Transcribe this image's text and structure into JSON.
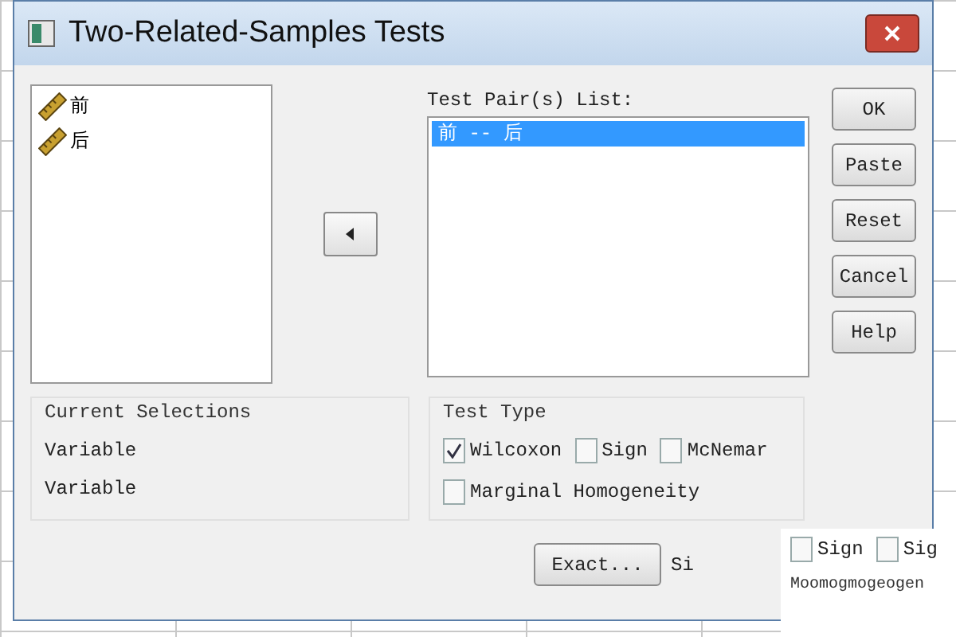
{
  "window": {
    "title": "Two-Related-Samples Tests"
  },
  "variables": [
    {
      "name": "前"
    },
    {
      "name": "后"
    }
  ],
  "test_pairs": {
    "label": "Test Pair(s) List:",
    "rows": [
      {
        "text": "前 -- 后",
        "selected": true
      }
    ]
  },
  "buttons": [
    "OK",
    "Paste",
    "Reset",
    "Cancel",
    "Help"
  ],
  "current_selections": {
    "title": "Current Selections",
    "rows": [
      "Variable",
      "Variable"
    ]
  },
  "test_type": {
    "title": "Test Type",
    "rows": [
      [
        {
          "label": "Wilcoxon",
          "checked": true
        },
        {
          "label": "Sign",
          "checked": false
        },
        {
          "label": "McNemar",
          "checked": false
        }
      ],
      [
        {
          "label": "Marginal Homogeneity",
          "checked": false
        }
      ]
    ]
  },
  "exact_button": "Exact...",
  "cut_button_text": "Si",
  "overlay": {
    "options": [
      {
        "label": "Sign",
        "checked": false
      },
      {
        "label": "Sig",
        "checked": false
      }
    ],
    "text": "Moomogmogeogen"
  }
}
